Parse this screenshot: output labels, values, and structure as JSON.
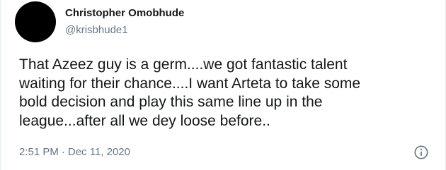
{
  "user": {
    "display_name": "Christopher Omobhude",
    "handle": "@krisbhude1",
    "avatar_color": "#000000"
  },
  "tweet": {
    "lines": [
      "That Azeez guy is a germ....we got fantastic talent",
      "waiting for their chance....I want Arteta to take some",
      "bold decision and play this same line up in the",
      "league...after all we dey loose before.."
    ],
    "time": "2:51 PM",
    "separator": "·",
    "date": "Dec 11, 2020"
  },
  "icons": {
    "info": "info-circle-icon"
  },
  "colors": {
    "text": "#14171a",
    "secondary": "#657786"
  }
}
